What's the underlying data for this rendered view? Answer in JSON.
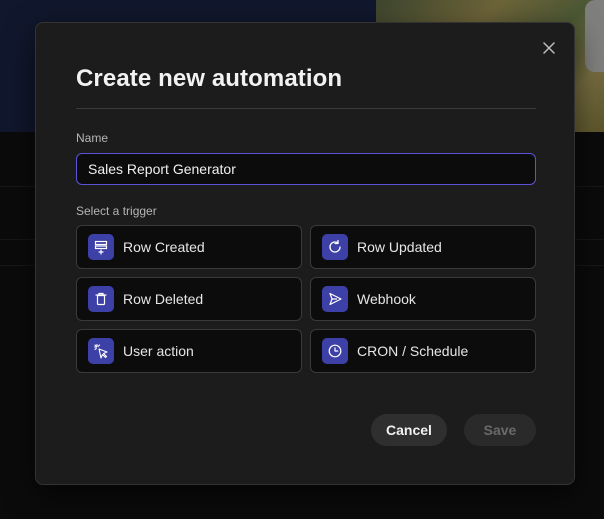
{
  "modal": {
    "title": "Create new automation",
    "name_label": "Name",
    "name_value": "Sales Report Generator",
    "trigger_label": "Select a trigger",
    "triggers": [
      {
        "label": "Row Created",
        "icon": "row-created-icon"
      },
      {
        "label": "Row Updated",
        "icon": "refresh-icon"
      },
      {
        "label": "Row Deleted",
        "icon": "trash-icon"
      },
      {
        "label": "Webhook",
        "icon": "send-icon"
      },
      {
        "label": "User action",
        "icon": "cursor-click-icon"
      },
      {
        "label": "CRON / Schedule",
        "icon": "clock-icon"
      }
    ],
    "cancel_label": "Cancel",
    "save_label": "Save"
  },
  "colors": {
    "accent": "#5b53d6",
    "icon_bg": "#3d40a6",
    "modal_bg": "#1c1c1c"
  }
}
